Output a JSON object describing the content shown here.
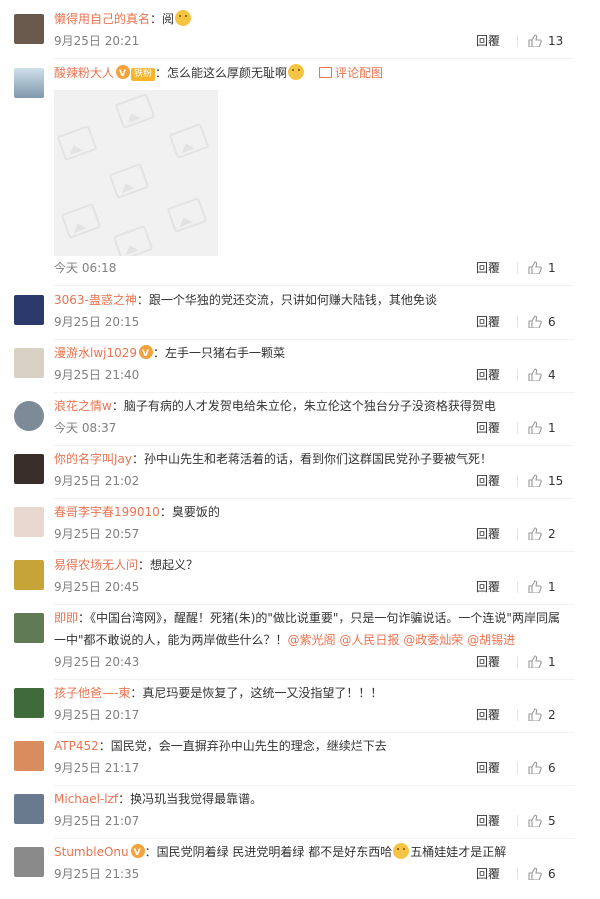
{
  "comments": [
    {
      "user": "懒得用自己的真名",
      "text": "：阅",
      "emoji": true,
      "time": "9月25日 20:21",
      "reply": "回覆",
      "likes": "13",
      "avatar_color": "#6a5a4e"
    },
    {
      "user": "酸辣粉大人",
      "text": "：怎么能这么厚颜无耻啊",
      "emoji": true,
      "time": "今天 06:18",
      "reply": "回覆",
      "likes": "1",
      "avatar_color": "#9fb6c6",
      "fan_badge": "铁粉",
      "pic_link": "评论配图"
    },
    {
      "user": "3063-蛊惑之神",
      "text": "：跟一个华独的党还交流，只讲如何赚大陆钱，其他免谈",
      "time": "9月25日 20:15",
      "reply": "回覆",
      "likes": "6",
      "avatar_color": "#2b3a6b"
    },
    {
      "user": "漫游水lwj1029",
      "text": "：左手一只猪右手一颗菜",
      "time": "9月25日 21:40",
      "reply": "回覆",
      "likes": "4",
      "avatar_color": "#d9d2c4",
      "vip": true
    },
    {
      "user": "浪花之情w",
      "text": "：脑子有病的人才发贺电给朱立伦，朱立伦这个独台分子没资格获得贺电",
      "time": "今天 08:37",
      "reply": "回覆",
      "likes": "1",
      "avatar_color": "#7d8a98"
    },
    {
      "user": "你的名字叫Jay",
      "text": "：孙中山先生和老蒋活着的话，看到你们这群国民党孙子要被气死！",
      "time": "9月25日 21:02",
      "reply": "回覆",
      "likes": "15",
      "avatar_color": "#3a2e2a"
    },
    {
      "user": "春哥李宇春199010",
      "text": "：臭要饭的",
      "time": "9月25日 20:57",
      "reply": "回覆",
      "likes": "2",
      "avatar_color": "#e8d8d0"
    },
    {
      "user": "易得农场无人问",
      "text": "：想起义？",
      "time": "9月25日 20:45",
      "reply": "回覆",
      "likes": "1",
      "avatar_color": "#c7a43a"
    },
    {
      "user": "即即",
      "text": "：《中国台湾网》，醒醒！死猪(朱)的\"做比说重要\"，只是一句诈骗说话。一个连说\"两岸同属",
      "text2": "一中\"都不敢说的人，能为两岸做些什么？！",
      "mentions": [
        "@紫光阁",
        "@人民日报",
        "@政委灿荣",
        "@胡锡进"
      ],
      "time": "9月25日 20:43",
      "reply": "回覆",
      "likes": "1",
      "avatar_color": "#5f7a54"
    },
    {
      "user": "孩子他爸—-東",
      "text": "：真尼玛要是恢复了，这统一又没指望了！！！",
      "time": "9月25日 20:17",
      "reply": "回覆",
      "likes": "2",
      "avatar_color": "#3f6b3a"
    },
    {
      "user": "ATP452",
      "text": "：国民党，会一直摒弃孙中山先生的理念，继续烂下去",
      "time": "9月25日 21:17",
      "reply": "回覆",
      "likes": "6",
      "avatar_color": "#d98c5e"
    },
    {
      "user": "Michael-lzf",
      "text": "：换冯玑当我觉得最靠谱。",
      "time": "9月25日 21:07",
      "reply": "回覆",
      "likes": "5",
      "avatar_color": "#6a7a8e"
    },
    {
      "user": "StumbleOnu",
      "text": "：国民党阴着绿 民进党明着绿 都不是好东西哈",
      "text_after": "五桶娃娃才是正解",
      "emoji": true,
      "time": "9月25日 21:35",
      "reply": "回覆",
      "likes": "6",
      "avatar_color": "#8a8a8a",
      "vip": true
    }
  ],
  "colors": {
    "username": "#eb7350",
    "time": "#808080",
    "text": "#333333"
  }
}
